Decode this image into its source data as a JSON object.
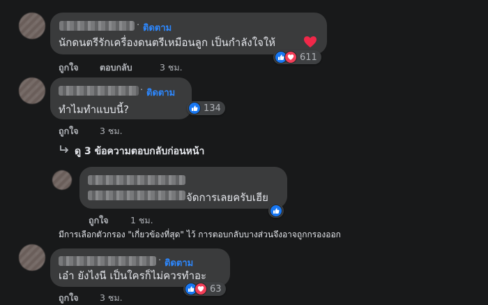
{
  "colors": {
    "background": "#18191a",
    "bubble": "#3a3b3c",
    "link_blue": "#2d88ff",
    "like_blue": "#1877f2",
    "love_red": "#f33e58"
  },
  "comments": [
    {
      "follow_label": "ติดตาม",
      "text": "นักดนตรีรักเครื่องดนตรีเหมือนลูก เป็นกำลังใจให้",
      "like_label": "ถูกใจ",
      "reply_label": "ตอบกลับ",
      "time": "3 ชม.",
      "reactions": [
        "like-icon",
        "love-icon"
      ],
      "reaction_count": "611"
    },
    {
      "follow_label": "ติดตาม",
      "text": "ทำไมทำแบบนี้?",
      "like_label": "ถูกใจ",
      "time": "3 ชม.",
      "reactions": [
        "like-icon"
      ],
      "reaction_count": "134"
    },
    {
      "follow_label": "ติดตาม",
      "text": "เอ๋า ยังไงนี เป็นใครก็ไม่ควรทำอะ",
      "like_label": "ถูกใจ",
      "time": "3 ชม.",
      "reactions": [
        "like-icon",
        "love-icon"
      ],
      "reaction_count": "63"
    }
  ],
  "view_previous_replies": "ดู 3 ข้อความตอบกลับก่อนหน้า",
  "reply": {
    "text": "จัดการเลยครับเฮีย",
    "like_label": "ถูกใจ",
    "time": "1 ชม.",
    "reactions": [
      "like-icon"
    ]
  },
  "filter_note": "มีการเลือกตัวกรอง \"เกี่ยวข้องที่สุด\" ไว้ การตอบกลับบางส่วนจึงอาจถูกกรองออก"
}
